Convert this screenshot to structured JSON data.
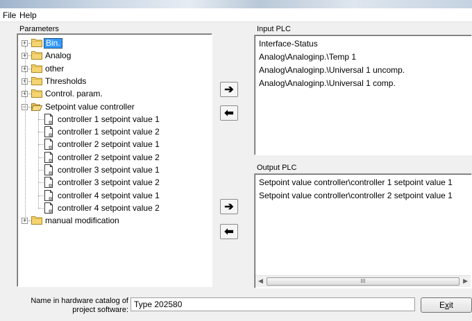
{
  "menu": {
    "items": [
      "File",
      "Help"
    ]
  },
  "parameters": {
    "label": "Parameters",
    "tree": [
      {
        "label": "Bin.",
        "expanded": false,
        "selected": true
      },
      {
        "label": "Analog",
        "expanded": false
      },
      {
        "label": "other",
        "expanded": false
      },
      {
        "label": "Thresholds",
        "expanded": false
      },
      {
        "label": "Control. param.",
        "expanded": false
      },
      {
        "label": "Setpoint value controller",
        "expanded": true,
        "children": [
          "controller 1 setpoint value 1",
          "controller 1 setpoint value 2",
          "controller 2 setpoint value 1",
          "controller 2 setpoint value 2",
          "controller 3 setpoint value 1",
          "controller 3 setpoint value 2",
          "controller 4 setpoint value 1",
          "controller 4 setpoint value 2"
        ]
      },
      {
        "label": "manual modification",
        "expanded": false
      }
    ]
  },
  "input_plc": {
    "label": "Input PLC",
    "items": [
      "Interface-Status",
      "Analog\\Analoginp.\\Temp 1",
      "Analog\\Analoginp.\\Universal 1 uncomp.",
      "Analog\\Analoginp.\\Universal 1 comp."
    ]
  },
  "output_plc": {
    "label": "Output PLC",
    "items": [
      "Setpoint value controller\\controller 1 setpoint value 1",
      "Setpoint value controller\\controller 2 setpoint value 1"
    ],
    "scroll_thumb_text": "III"
  },
  "buttons": {
    "add_arrow": "➔",
    "remove_arrow": "⬅"
  },
  "hardware": {
    "label_line1": "Name in hardware catalog of",
    "label_line2": "project software:",
    "value": "Type 202580"
  },
  "exit": {
    "label_prefix": "E",
    "label_accel": "x",
    "label_suffix": "it"
  }
}
